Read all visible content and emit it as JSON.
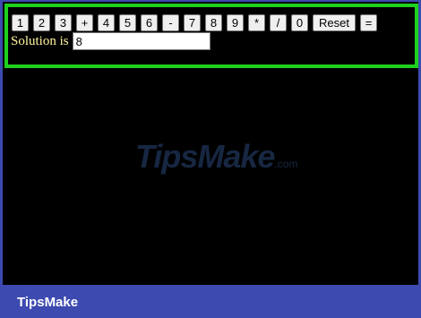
{
  "calculator": {
    "keys": [
      "1",
      "2",
      "3",
      "+",
      "4",
      "5",
      "6",
      "-",
      "7",
      "8",
      "9",
      "*",
      "/",
      "0",
      "Reset",
      "="
    ],
    "solution_label": "Solution is",
    "solution_value": "8"
  },
  "watermark": {
    "main": "TipsMake",
    "tld": ".com"
  },
  "footer": {
    "brand": "TipsMake"
  },
  "colors": {
    "border": "#1fd11f",
    "footer_bg": "#3d4ab0",
    "label": "#fff3a0"
  }
}
